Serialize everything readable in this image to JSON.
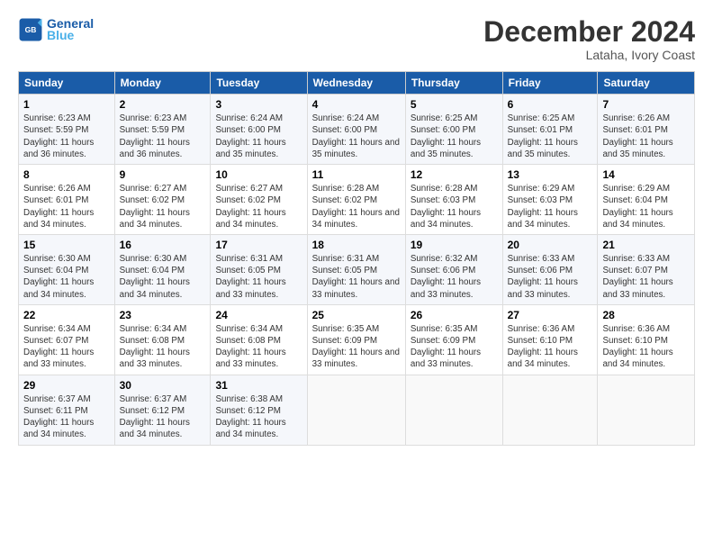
{
  "header": {
    "logo_line1": "General",
    "logo_line2": "Blue",
    "month_year": "December 2024",
    "location": "Lataha, Ivory Coast"
  },
  "columns": [
    "Sunday",
    "Monday",
    "Tuesday",
    "Wednesday",
    "Thursday",
    "Friday",
    "Saturday"
  ],
  "weeks": [
    [
      {
        "day": "1",
        "rise": "6:23 AM",
        "set": "5:59 PM",
        "light": "11 hours and 36 minutes."
      },
      {
        "day": "2",
        "rise": "6:23 AM",
        "set": "5:59 PM",
        "light": "11 hours and 36 minutes."
      },
      {
        "day": "3",
        "rise": "6:24 AM",
        "set": "6:00 PM",
        "light": "11 hours and 35 minutes."
      },
      {
        "day": "4",
        "rise": "6:24 AM",
        "set": "6:00 PM",
        "light": "11 hours and 35 minutes."
      },
      {
        "day": "5",
        "rise": "6:25 AM",
        "set": "6:00 PM",
        "light": "11 hours and 35 minutes."
      },
      {
        "day": "6",
        "rise": "6:25 AM",
        "set": "6:01 PM",
        "light": "11 hours and 35 minutes."
      },
      {
        "day": "7",
        "rise": "6:26 AM",
        "set": "6:01 PM",
        "light": "11 hours and 35 minutes."
      }
    ],
    [
      {
        "day": "8",
        "rise": "6:26 AM",
        "set": "6:01 PM",
        "light": "11 hours and 34 minutes."
      },
      {
        "day": "9",
        "rise": "6:27 AM",
        "set": "6:02 PM",
        "light": "11 hours and 34 minutes."
      },
      {
        "day": "10",
        "rise": "6:27 AM",
        "set": "6:02 PM",
        "light": "11 hours and 34 minutes."
      },
      {
        "day": "11",
        "rise": "6:28 AM",
        "set": "6:02 PM",
        "light": "11 hours and 34 minutes."
      },
      {
        "day": "12",
        "rise": "6:28 AM",
        "set": "6:03 PM",
        "light": "11 hours and 34 minutes."
      },
      {
        "day": "13",
        "rise": "6:29 AM",
        "set": "6:03 PM",
        "light": "11 hours and 34 minutes."
      },
      {
        "day": "14",
        "rise": "6:29 AM",
        "set": "6:04 PM",
        "light": "11 hours and 34 minutes."
      }
    ],
    [
      {
        "day": "15",
        "rise": "6:30 AM",
        "set": "6:04 PM",
        "light": "11 hours and 34 minutes."
      },
      {
        "day": "16",
        "rise": "6:30 AM",
        "set": "6:04 PM",
        "light": "11 hours and 34 minutes."
      },
      {
        "day": "17",
        "rise": "6:31 AM",
        "set": "6:05 PM",
        "light": "11 hours and 33 minutes."
      },
      {
        "day": "18",
        "rise": "6:31 AM",
        "set": "6:05 PM",
        "light": "11 hours and 33 minutes."
      },
      {
        "day": "19",
        "rise": "6:32 AM",
        "set": "6:06 PM",
        "light": "11 hours and 33 minutes."
      },
      {
        "day": "20",
        "rise": "6:33 AM",
        "set": "6:06 PM",
        "light": "11 hours and 33 minutes."
      },
      {
        "day": "21",
        "rise": "6:33 AM",
        "set": "6:07 PM",
        "light": "11 hours and 33 minutes."
      }
    ],
    [
      {
        "day": "22",
        "rise": "6:34 AM",
        "set": "6:07 PM",
        "light": "11 hours and 33 minutes."
      },
      {
        "day": "23",
        "rise": "6:34 AM",
        "set": "6:08 PM",
        "light": "11 hours and 33 minutes."
      },
      {
        "day": "24",
        "rise": "6:34 AM",
        "set": "6:08 PM",
        "light": "11 hours and 33 minutes."
      },
      {
        "day": "25",
        "rise": "6:35 AM",
        "set": "6:09 PM",
        "light": "11 hours and 33 minutes."
      },
      {
        "day": "26",
        "rise": "6:35 AM",
        "set": "6:09 PM",
        "light": "11 hours and 33 minutes."
      },
      {
        "day": "27",
        "rise": "6:36 AM",
        "set": "6:10 PM",
        "light": "11 hours and 34 minutes."
      },
      {
        "day": "28",
        "rise": "6:36 AM",
        "set": "6:10 PM",
        "light": "11 hours and 34 minutes."
      }
    ],
    [
      {
        "day": "29",
        "rise": "6:37 AM",
        "set": "6:11 PM",
        "light": "11 hours and 34 minutes."
      },
      {
        "day": "30",
        "rise": "6:37 AM",
        "set": "6:12 PM",
        "light": "11 hours and 34 minutes."
      },
      {
        "day": "31",
        "rise": "6:38 AM",
        "set": "6:12 PM",
        "light": "11 hours and 34 minutes."
      },
      null,
      null,
      null,
      null
    ]
  ],
  "labels": {
    "sunrise": "Sunrise:",
    "sunset": "Sunset:",
    "daylight": "Daylight:"
  }
}
